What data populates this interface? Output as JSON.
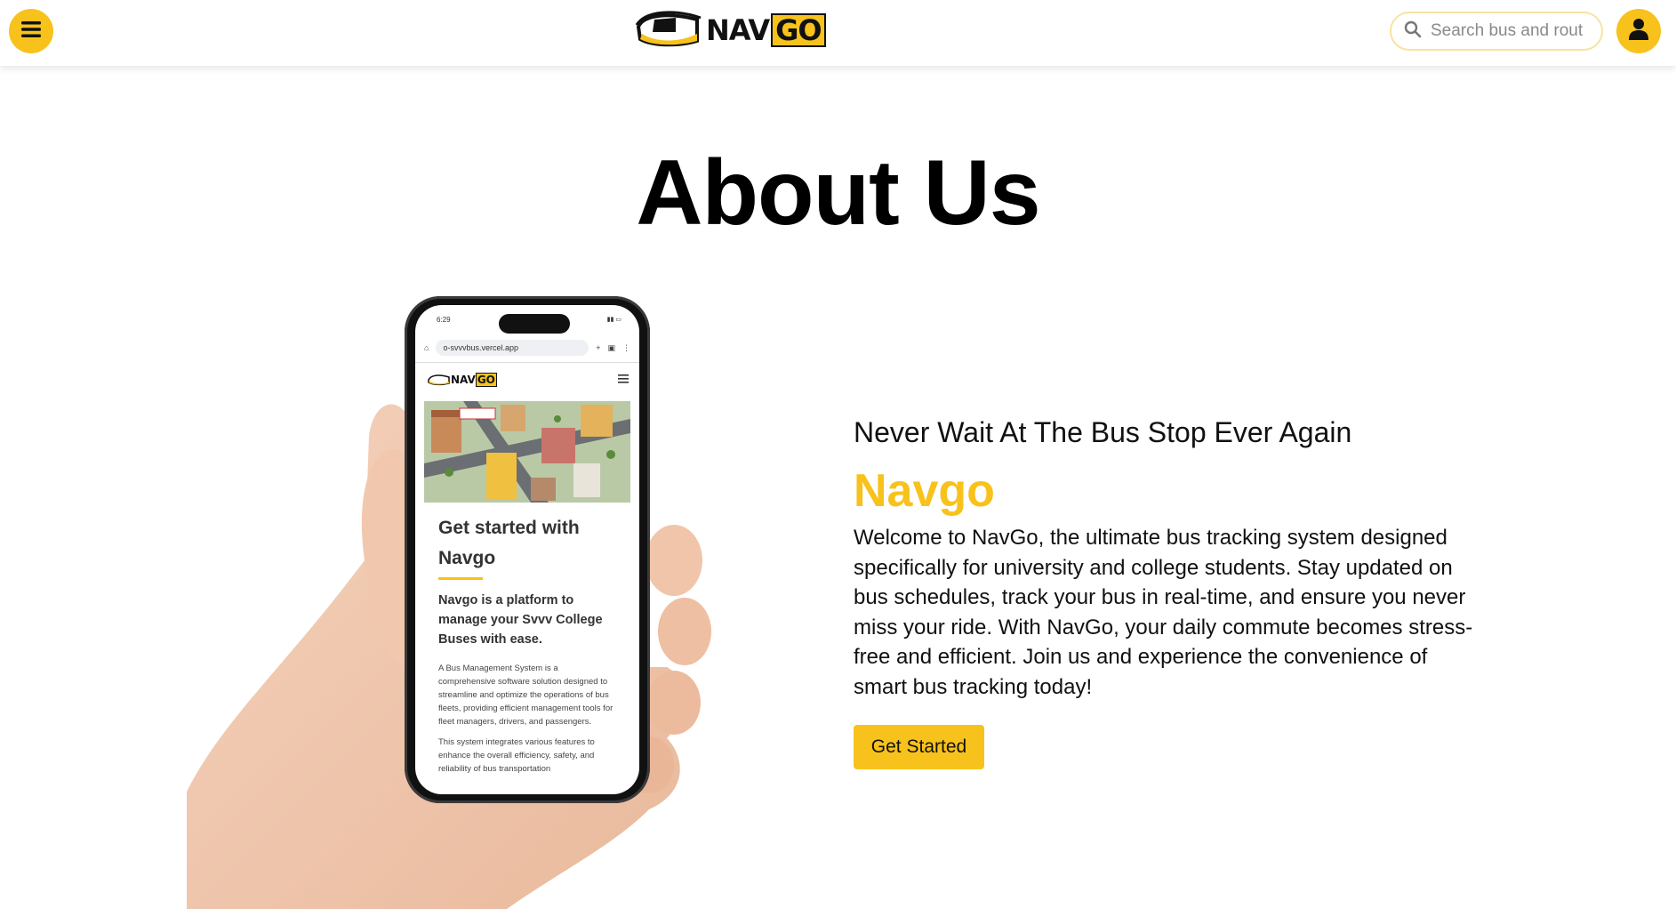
{
  "header": {
    "logo": {
      "part1": "NAV",
      "part2": "GO"
    },
    "search": {
      "placeholder": "Search bus and route",
      "value": ""
    }
  },
  "main": {
    "title": "About Us",
    "tagline": "Never Wait At The Bus Stop Ever Again",
    "brand_name": "Navgo",
    "description": "Welcome to NavGo, the ultimate bus tracking system designed specifically for university and college students. Stay updated on bus schedules, track your bus in real-time, and ensure you never miss your ride. With NavGo, your daily commute becomes stress-free and efficient. Join us and experience the convenience of smart bus tracking today!",
    "cta_label": "Get Started"
  },
  "phone": {
    "time": "6:29",
    "url": "o-svvvbus.vercel.app",
    "logo_part1": "NAV",
    "logo_part2": "GO",
    "heading": "Get started with Navgo",
    "subheading": "Navgo is a platform to manage your Svvv College Buses with ease.",
    "body1": "A Bus Management System is a comprehensive software solution designed to streamline and optimize the operations of bus fleets, providing efficient management tools for fleet managers, drivers, and passengers.",
    "body2": "This system integrates various features to enhance the overall efficiency, safety, and reliability of bus transportation"
  },
  "colors": {
    "accent": "#f8c21c",
    "text": "#111111",
    "background": "#ffffff"
  },
  "icons": [
    "hamburger-menu-icon",
    "bus-logo-icon",
    "search-icon",
    "user-icon",
    "home-icon",
    "plus-icon",
    "tabs-icon",
    "more-vertical-icon"
  ]
}
